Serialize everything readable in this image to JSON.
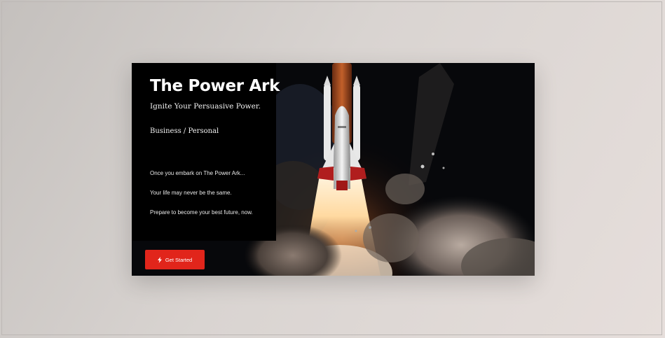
{
  "hero": {
    "title": "The Power Ark",
    "tagline": "Ignite Your Persuasive Power.",
    "category": "Business / Personal",
    "lines": [
      "Once you embark on The Power Ark...",
      "Your life may never be the same.",
      "Prepare to become your best future, now."
    ],
    "cta": {
      "label": "Get Started",
      "icon": "lightning-bolt-icon",
      "color": "#e1251b"
    },
    "image_description": "rocket launch with smoke clouds"
  },
  "colors": {
    "background": "#d9d4d1",
    "panel": "#000000",
    "accent": "#e1251b",
    "text": "#ffffff"
  }
}
